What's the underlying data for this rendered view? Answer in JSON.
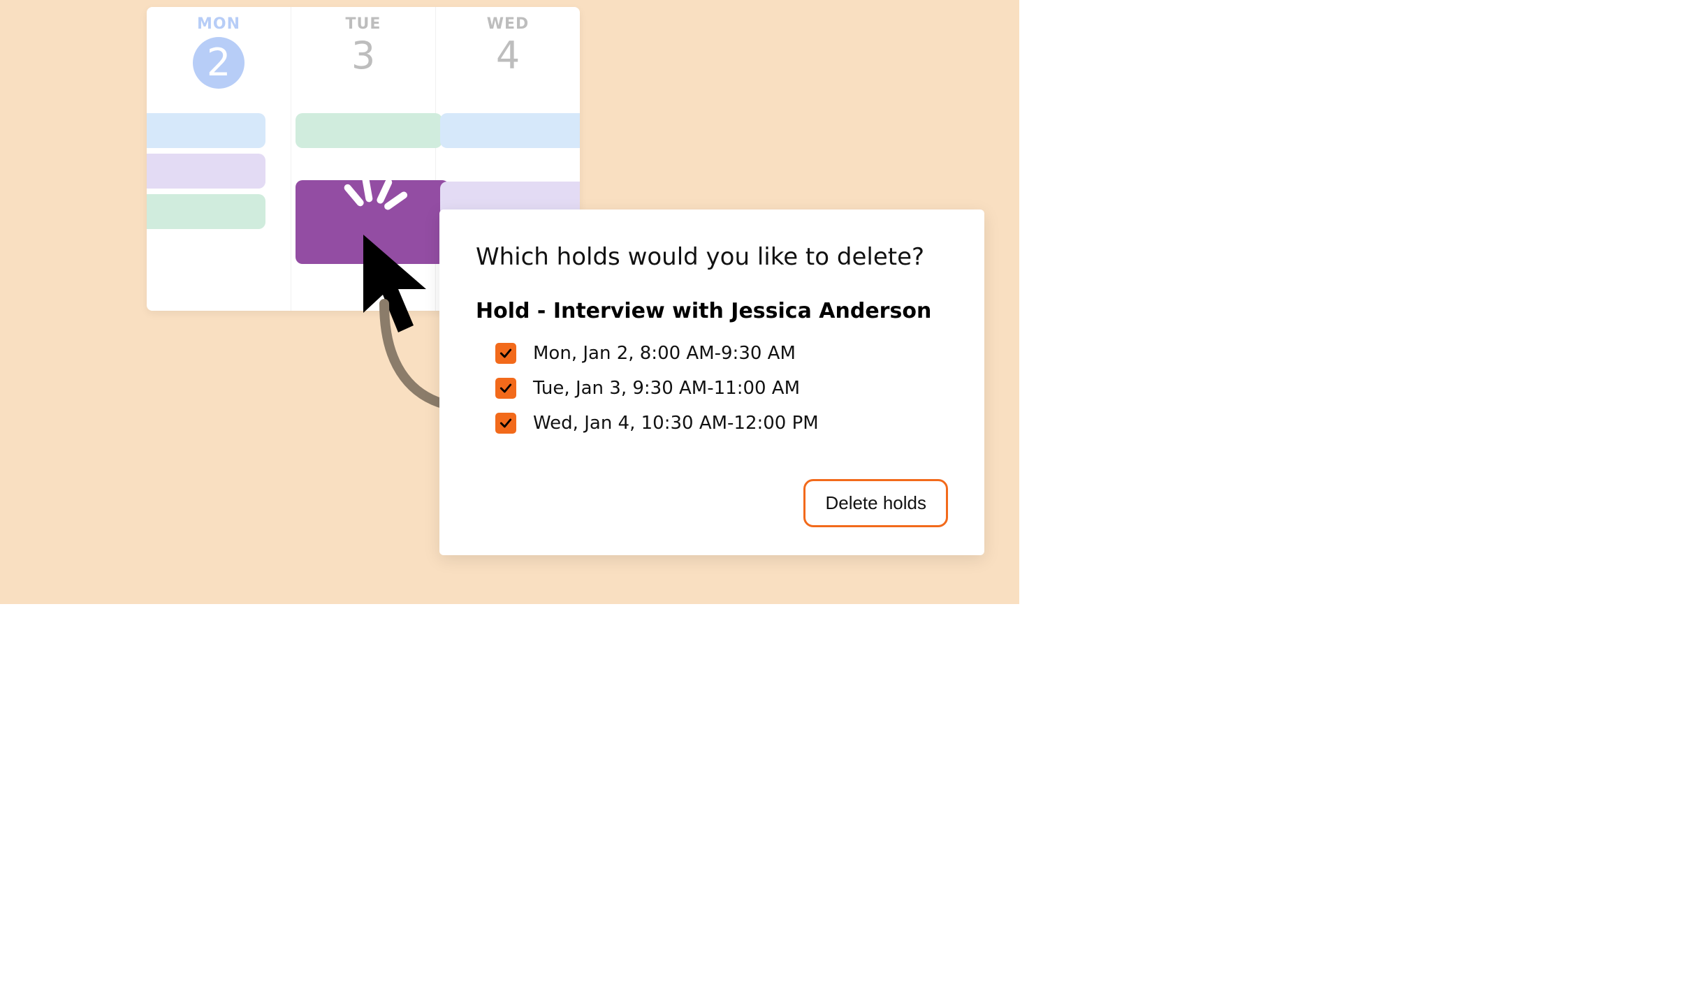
{
  "calendar": {
    "days": [
      {
        "dow": "MON",
        "num": "2",
        "today": true
      },
      {
        "dow": "TUE",
        "num": "3",
        "today": false
      },
      {
        "dow": "WED",
        "num": "4",
        "today": false
      }
    ]
  },
  "dialog": {
    "title": "Which holds would you like to delete?",
    "hold_group_title": "Hold - Interview with Jessica Anderson",
    "holds": [
      {
        "label": "Mon, Jan 2, 8:00 AM-9:30 AM",
        "checked": true
      },
      {
        "label": "Tue, Jan 3, 9:30 AM-11:00 AM",
        "checked": true
      },
      {
        "label": "Wed, Jan 4, 10:30 AM-12:00 PM",
        "checked": true
      }
    ],
    "delete_button": "Delete holds"
  },
  "colors": {
    "accent": "#f26a1b",
    "selected_event": "#934da3"
  }
}
